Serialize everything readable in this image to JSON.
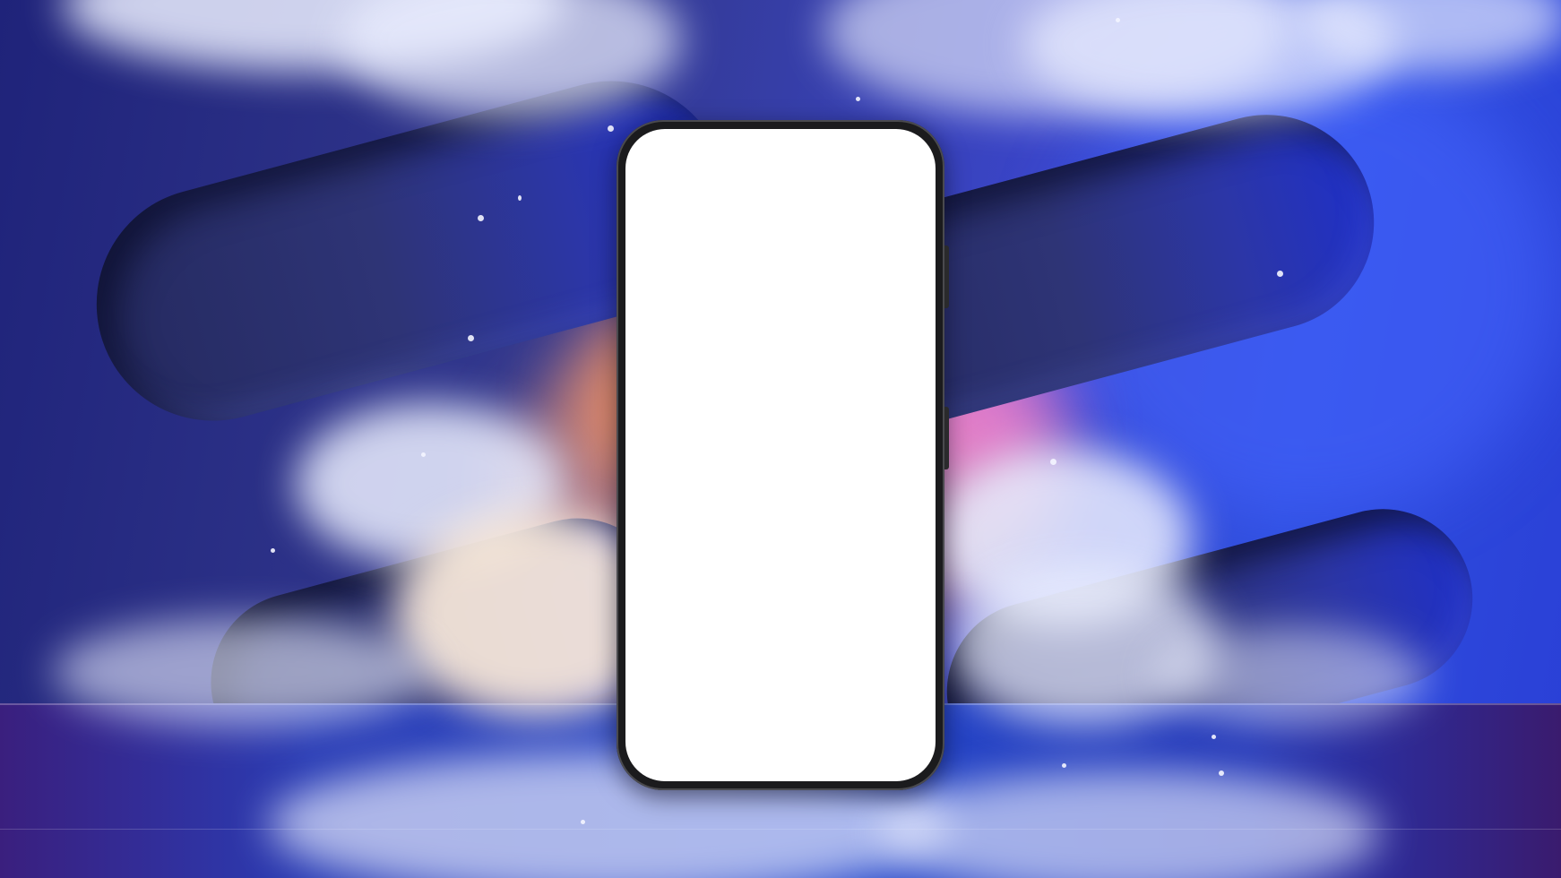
{
  "scene": {
    "background_colors": [
      "#1f237a",
      "#33398f",
      "#3a45c8",
      "#2f4fe0"
    ],
    "capsule_color": "#2e3476",
    "floor_color": "#2547c9",
    "phone": {
      "frame_color": "#1b1b1d",
      "screen_color": "#ffffff"
    }
  }
}
